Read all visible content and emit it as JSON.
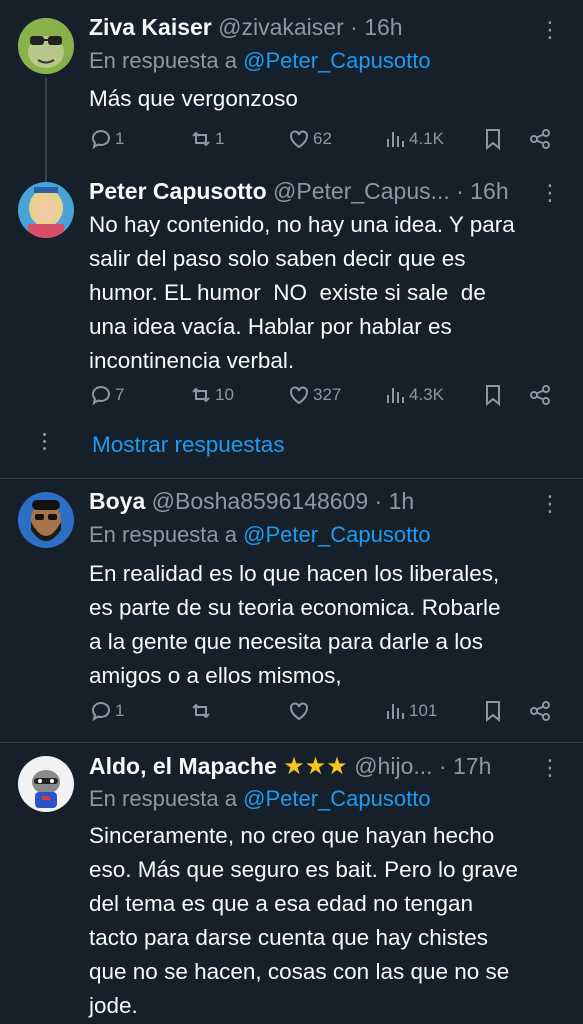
{
  "tweets": [
    {
      "name": "Ziva Kaiser",
      "handle": "@zivakaiser",
      "sep": "·",
      "time": "16h",
      "reply_prefix": "En respuesta a",
      "reply_to": "@Peter_Capusotto",
      "text": "Más que vergonzoso",
      "replies": "1",
      "retweets": "1",
      "likes": "62",
      "views": "4.1K",
      "avatar_icon": "frog-with-sunglasses-avatar"
    },
    {
      "name": "Peter Capusotto",
      "handle": "@Peter_Capus...",
      "sep": "·",
      "time": "16h",
      "text_lines": [
        "No hay contenido, no hay una idea. Y para",
        "salir del paso solo saben decir que es",
        "humor. EL humor  NO  existe si sale  de",
        "una idea vacía. Hablar por hablar es",
        "incontinencia verbal."
      ],
      "replies": "7",
      "retweets": "10",
      "likes": "327",
      "views": "4.3K",
      "avatar_icon": "blonde-person-avatar"
    },
    {
      "name": "Boya",
      "handle": "@Bosha8596148609",
      "sep": "·",
      "time": "1h",
      "reply_prefix": "En respuesta a",
      "reply_to": "@Peter_Capusotto",
      "text_lines": [
        "En realidad es lo que hacen los liberales,",
        "es parte de su teoria economica. Robarle",
        "a la gente que necesita para darle a los",
        "amigos o a ellos mismos,"
      ],
      "replies": "1",
      "retweets": "",
      "likes": "",
      "views": "101",
      "avatar_icon": "bearded-man-with-glasses-avatar"
    },
    {
      "name": "Aldo, el Mapache",
      "stars": "★★★",
      "handle": "@hijo...",
      "sep": "·",
      "time": "17h",
      "reply_prefix": "En respuesta a",
      "reply_to": "@Peter_Capusotto",
      "text_lines": [
        "Sinceramente, no creo que hayan hecho",
        "eso. Más que seguro es bait. Pero lo grave",
        "del tema es que a esa edad no tengan",
        "tacto para darse cuenta que hay chistes",
        "que no se hacen, cosas con las que no se",
        "jode."
      ],
      "avatar_icon": "raccoon-avatar"
    }
  ],
  "show_replies": "Mostrar respuestas",
  "more_glyph": "⋮",
  "colors": {
    "background": "#15202b",
    "text": "#f7f9f9",
    "secondary": "#8b98a5",
    "accent": "#1d9bf0",
    "divider": "#38444d"
  }
}
